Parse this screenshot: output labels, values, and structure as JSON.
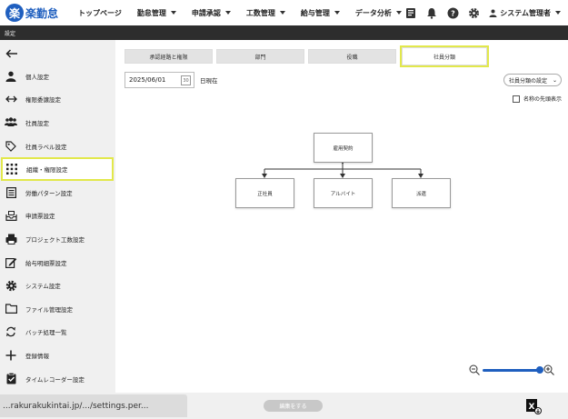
{
  "app": {
    "logo_mark": "楽",
    "logo_text": "楽勤怠"
  },
  "nav": {
    "items": [
      {
        "label": "トップページ",
        "caret": false
      },
      {
        "label": "勤怠管理",
        "caret": true
      },
      {
        "label": "申請承認",
        "caret": true
      },
      {
        "label": "工数管理",
        "caret": true
      },
      {
        "label": "給与管理",
        "caret": true
      },
      {
        "label": "データ分析",
        "caret": true
      }
    ],
    "icons": [
      "checklist-icon",
      "bell-icon",
      "help-icon",
      "gear-icon"
    ],
    "user_label": "システム管理者"
  },
  "breadcrumb": "設定",
  "sidebar": {
    "items": [
      {
        "label": "個人設定",
        "icon": "person-icon"
      },
      {
        "label": "権限委譲設定",
        "icon": "swap-arrows-icon"
      },
      {
        "label": "社員設定",
        "icon": "people-icon"
      },
      {
        "label": "社員ラベル設定",
        "icon": "tag-icon"
      },
      {
        "label": "組織・権限設定",
        "icon": "grid-dots-icon",
        "active": true
      },
      {
        "label": "労働パターン設定",
        "icon": "list-doc-icon"
      },
      {
        "label": "申請票設定",
        "icon": "inbox-icon"
      },
      {
        "label": "プロジェクト工数設定",
        "icon": "printer-icon"
      },
      {
        "label": "給与明細票設定",
        "icon": "edit-doc-icon"
      },
      {
        "label": "システム設定",
        "icon": "gear-icon"
      },
      {
        "label": "ファイル管理設定",
        "icon": "folder-icon"
      },
      {
        "label": "バッチ処理一覧",
        "icon": "sync-icon"
      },
      {
        "label": "登録情報",
        "icon": "plus-icon"
      },
      {
        "label": "タイムレコーダー設定",
        "icon": "clipboard-check-icon"
      }
    ]
  },
  "tabs": [
    {
      "label": "承認経路と権限",
      "selected": false
    },
    {
      "label": "部門",
      "selected": false
    },
    {
      "label": "役職",
      "selected": false
    },
    {
      "label": "社員分類",
      "selected": true
    }
  ],
  "date": {
    "value": "2025/06/01",
    "calendar_glyph": "30",
    "suffix": "日現在"
  },
  "setting_select": "社員分類の設定",
  "show_top_name_label": "名称の先頭表示",
  "org_chart": {
    "root": "雇用契約",
    "children": [
      "正社員",
      "アルバイト",
      "派遣"
    ]
  },
  "bottom": {
    "url": "...rakurakukintai.jp/.../settings.per...",
    "edit_button": "編集をする"
  },
  "colors": {
    "brand": "#1f5fbf",
    "highlight": "#e2e84b",
    "dark_bar": "#2d2d2d"
  }
}
